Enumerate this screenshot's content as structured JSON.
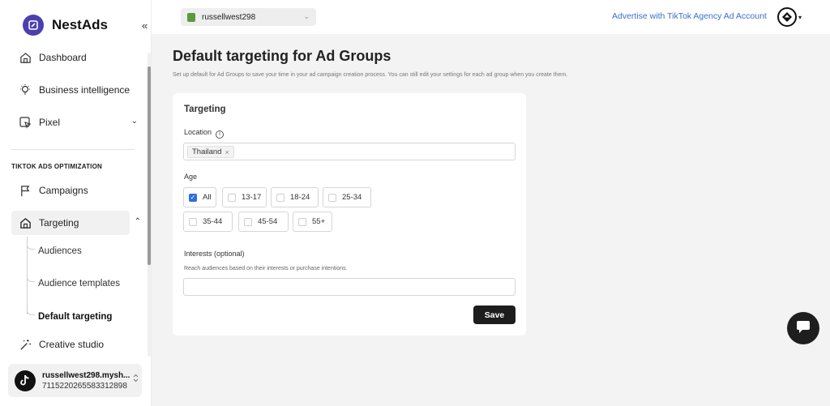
{
  "brand": {
    "name": "NestAds",
    "collapse_icon": "«"
  },
  "sidebar": {
    "items": [
      {
        "label": "Dashboard",
        "icon": "home-icon"
      },
      {
        "label": "Business intelligence",
        "icon": "lightbulb-icon"
      },
      {
        "label": "Pixel",
        "icon": "cursor-icon",
        "chevron": "⌄"
      }
    ],
    "section_label": "TIKTOK ADS OPTIMIZATION",
    "campaigns": {
      "label": "Campaigns",
      "icon": "flag-icon"
    },
    "targeting": {
      "label": "Targeting",
      "icon": "home-icon",
      "chevron": "⌃"
    },
    "sub_items": [
      "Audiences",
      "Audience templates",
      "Default targeting"
    ],
    "creative": {
      "label": "Creative studio",
      "icon": "magic-wand-icon"
    },
    "account": {
      "name": "russellwest298.mysh...",
      "id": "7115220265583312898",
      "toggle": "⌃⌄"
    }
  },
  "topbar": {
    "store": "russellwest298",
    "store_caret": "⌄",
    "advertise_link": "Advertise with TikTok Agency Ad Account",
    "user_caret": "▾"
  },
  "page": {
    "title": "Default targeting for Ad Groups",
    "subtitle": "Set up default for Ad Groups to save your time in your ad campaign creation process. You can still edit your settings for each ad group when you create them."
  },
  "targeting_card": {
    "title": "Targeting",
    "location_label": "Location",
    "location_tag": "Thailand",
    "tag_remove": "×",
    "age_label": "Age",
    "age_options": [
      {
        "label": "All",
        "checked": true
      },
      {
        "label": "13-17",
        "checked": false
      },
      {
        "label": "18-24",
        "checked": false
      },
      {
        "label": "25-34",
        "checked": false
      },
      {
        "label": "35-44",
        "checked": false
      },
      {
        "label": "45-54",
        "checked": false
      },
      {
        "label": "55+",
        "checked": false
      }
    ],
    "interests_label": "Interests (optional)",
    "interests_help": "Reach audiences based on their interests or purchase intentions.",
    "interests_value": "",
    "save_label": "Save"
  },
  "colors": {
    "accent": "#2f6fde",
    "brand": "#4b3fb0",
    "link": "#3a6fd0",
    "button": "#1d1d1d"
  }
}
